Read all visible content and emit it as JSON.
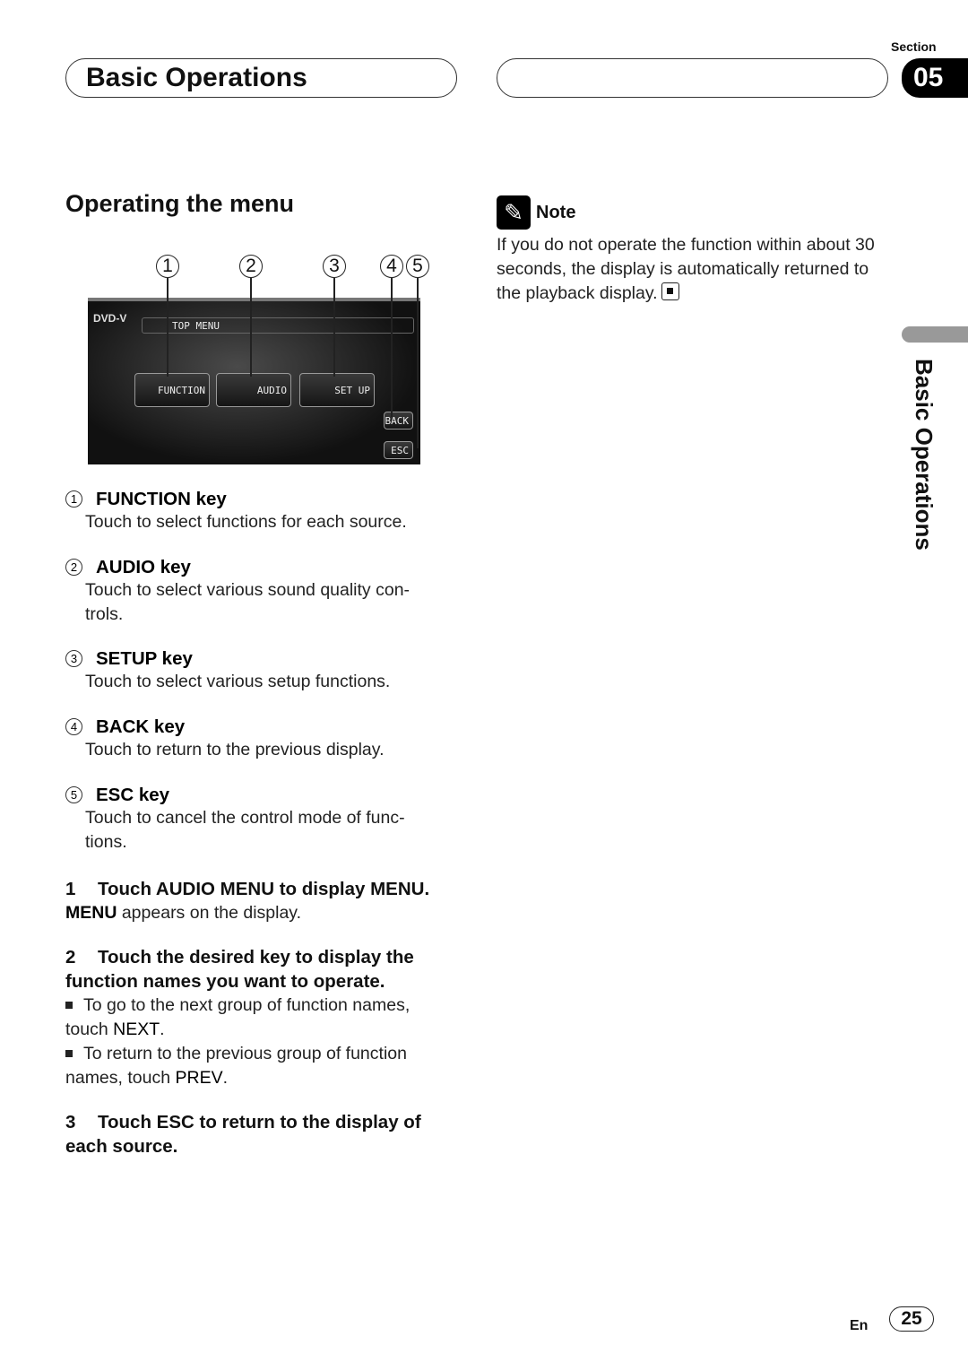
{
  "header": {
    "title": "Basic Operations",
    "section_label": "Section",
    "section_number": "05"
  },
  "side_tab": "Basic Operations",
  "main": {
    "heading": "Operating the menu",
    "figure": {
      "callouts": [
        "1",
        "2",
        "3",
        "4",
        "5"
      ],
      "screen": {
        "source": "DVD-V",
        "title": "TOP MENU",
        "buttons": [
          "FUNCTION",
          "AUDIO",
          "SET UP"
        ],
        "back": "BACK",
        "esc": "ESC"
      }
    },
    "keys": [
      {
        "num": "1",
        "title": "FUNCTION key",
        "desc": "Touch to select functions for each source."
      },
      {
        "num": "2",
        "title": "AUDIO key",
        "desc": "Touch to select various sound quality con-\ntrols."
      },
      {
        "num": "3",
        "title": "SETUP key",
        "desc": "Touch to select various setup functions."
      },
      {
        "num": "4",
        "title": "BACK key",
        "desc": "Touch to return to the previous display."
      },
      {
        "num": "5",
        "title": "ESC key",
        "desc": "Touch to cancel the control mode of func-\ntions."
      }
    ],
    "steps": [
      {
        "num": "1",
        "title": "Touch AUDIO MENU to display MENU.",
        "bold": "MENU",
        "text": " appears on the display."
      },
      {
        "num": "2",
        "title": "Touch the desired key to display the",
        "title2": "function names you want to operate.",
        "bullets": [
          {
            "text": "To go to the next group of function names,",
            "text2": "touch ",
            "bold": "NEXT",
            "end": "."
          },
          {
            "text": "To return to the previous group of function",
            "text2": "names, touch ",
            "bold": "PREV",
            "end": "."
          }
        ]
      },
      {
        "num": "3",
        "title": "Touch ESC to return to the display of",
        "title2": "each source."
      }
    ]
  },
  "note": {
    "label": "Note",
    "lines": [
      "If you do not operate the function within about 30",
      "seconds, the display is automatically returned to",
      "the playback display."
    ]
  },
  "footer": {
    "lang": "En",
    "page": "25"
  }
}
